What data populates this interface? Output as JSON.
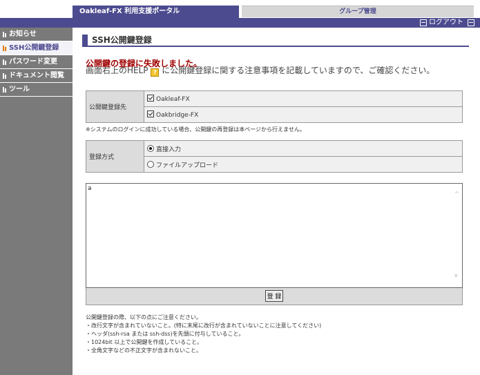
{
  "header": {
    "portal_title": "Oakleaf-FX 利用支援ポータル",
    "group_tab": "グループ管理",
    "logout": "ログアウト"
  },
  "sidebar": {
    "items": [
      {
        "label": "お知らせ",
        "active": false
      },
      {
        "label": "SSH公開鍵登録",
        "active": true
      },
      {
        "label": "パスワード変更",
        "active": false
      },
      {
        "label": "ドキュメント閲覧",
        "active": false
      },
      {
        "label": "ツール",
        "active": false
      }
    ]
  },
  "main": {
    "title": "SSH公開鍵登録",
    "error_title": "公開鍵の登録に失敗しました。",
    "error_msg_before": "画面右上のHELP",
    "error_msg_after": "に公開鍵登録に関する注意事項を記載していますので、ご確認ください。",
    "target": {
      "label": "公開鍵登録先",
      "options": [
        {
          "label": "Oakleaf-FX",
          "checked": true
        },
        {
          "label": "Oakbridge-FX",
          "checked": true
        }
      ]
    },
    "target_note": "※システムのログインに成功している場合、公開鍵の再登録は本ページから行えません。",
    "method": {
      "label": "登録方式",
      "options": [
        {
          "label": "直接入力",
          "selected": true
        },
        {
          "label": "ファイルアップロード",
          "selected": false
        }
      ]
    },
    "key_value": "a",
    "submit_label": "登 録",
    "guidance": [
      "公開鍵登録の際、以下の点にご注意ください。",
      "・改行文字が含まれていないこと。(特に末尾に改行が含まれていないことに注意してください)",
      "・ヘッダ(ssh-rsa または ssh-dss)を先頭に付与していること。",
      "・1024bit 以上で公開鍵を作成していること。",
      "・全角文字などの不正文字が含まれないこと。"
    ]
  }
}
